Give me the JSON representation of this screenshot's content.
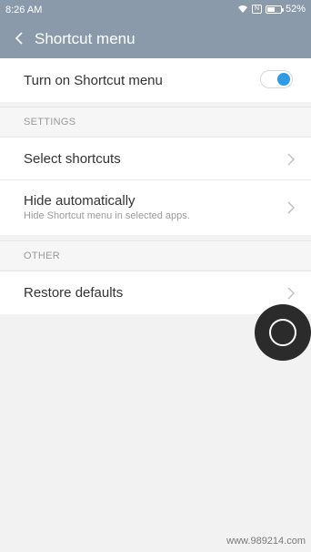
{
  "status_bar": {
    "time": "8:26 AM",
    "battery": "52%",
    "nfc_label": "N"
  },
  "header": {
    "title": "Shortcut menu"
  },
  "main_toggle": {
    "label": "Turn on Shortcut menu",
    "enabled": true
  },
  "settings_section": {
    "header": "SETTINGS",
    "items": [
      {
        "label": "Select shortcuts"
      },
      {
        "label": "Hide automatically",
        "subtitle": "Hide Shortcut menu in selected apps."
      }
    ]
  },
  "other_section": {
    "header": "OTHER",
    "items": [
      {
        "label": "Restore defaults"
      }
    ]
  },
  "watermark": "www.989214.com",
  "colors": {
    "header_bg": "#8a9aab",
    "toggle_accent": "#2d9be8",
    "fab_bg": "#2b2b2b"
  }
}
